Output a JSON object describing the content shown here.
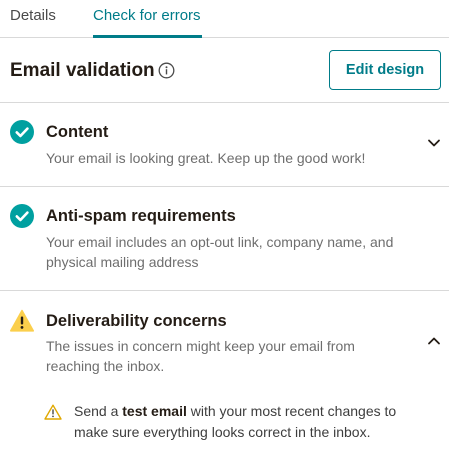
{
  "tabs": [
    {
      "label": "Details",
      "active": false
    },
    {
      "label": "Check for errors",
      "active": true
    }
  ],
  "header": {
    "title": "Email validation",
    "edit_button": "Edit design"
  },
  "colors": {
    "accent": "#007c89",
    "success": "#00a0a0",
    "warning": "#fbcf4c"
  },
  "sections": [
    {
      "title": "Content",
      "description": "Your email is looking great. Keep up the good work!",
      "status": "success",
      "icon": "check-circle-icon",
      "expanded": false
    },
    {
      "title": "Anti-spam requirements",
      "description": "Your email includes an opt-out link, company name, and physical mailing address",
      "status": "success",
      "icon": "check-circle-icon"
    },
    {
      "title": "Deliverability concerns",
      "description": "The issues in concern might keep your email from reaching the inbox.",
      "status": "warning",
      "icon": "warning-icon",
      "expanded": true,
      "concerns": [
        {
          "prefix": "Send a ",
          "bold": "test email",
          "suffix": " with your most recent changes to make sure everything looks correct in the inbox."
        }
      ]
    }
  ]
}
